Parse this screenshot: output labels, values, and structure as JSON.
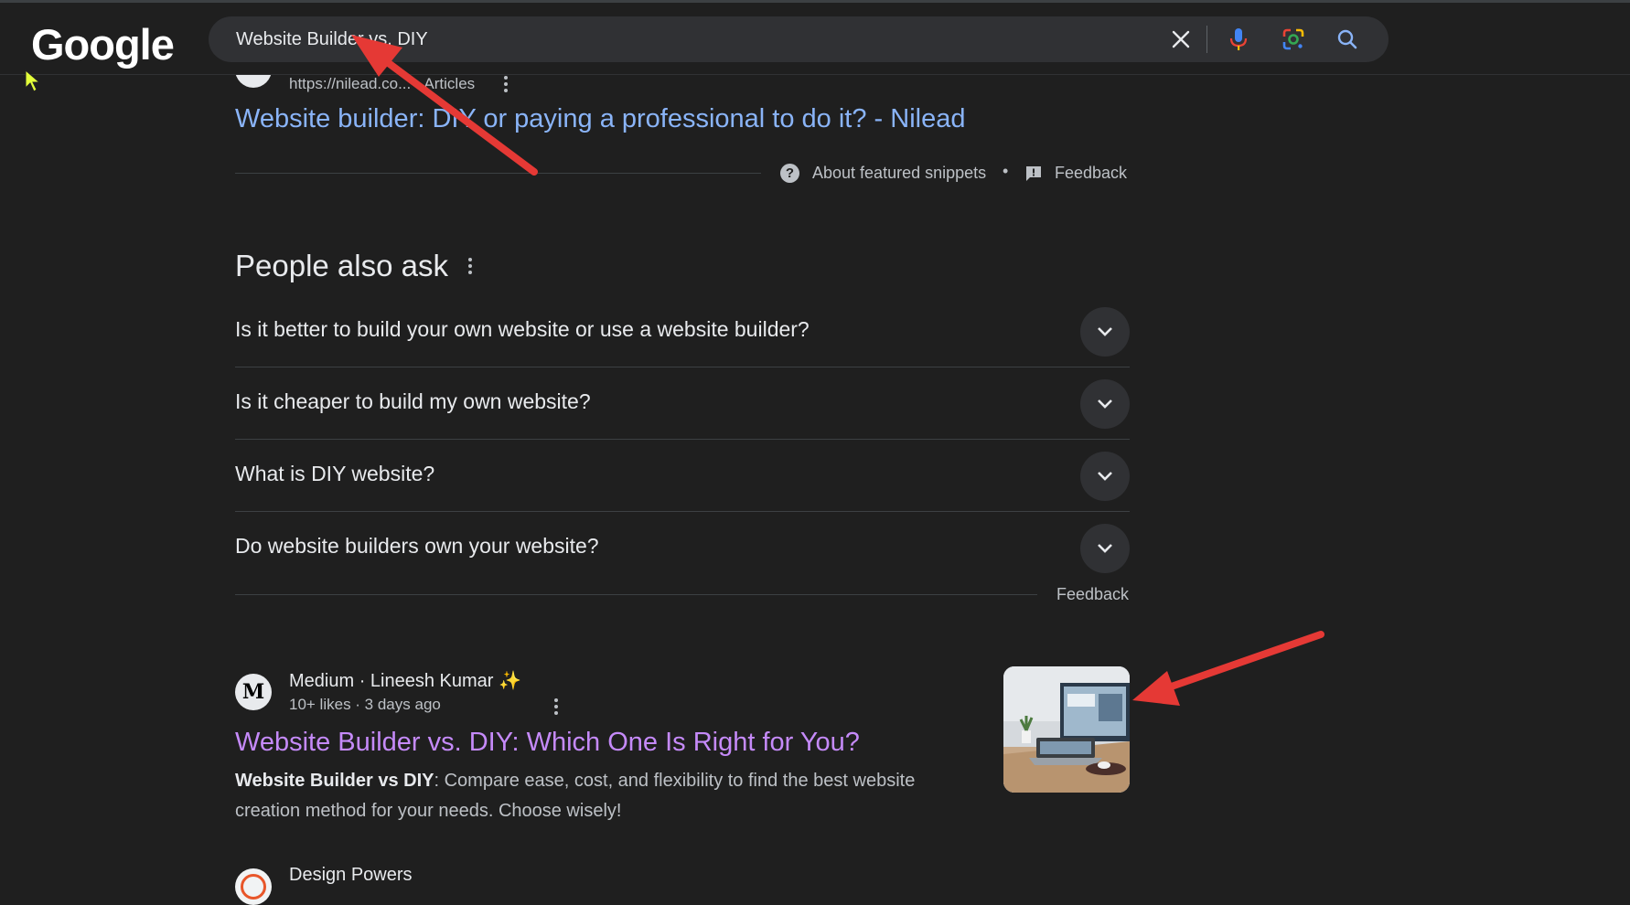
{
  "logo": "Google",
  "search": {
    "query": "Website Builder vs. DIY"
  },
  "icons": {
    "clear": "close-icon",
    "voice": "microphone-icon",
    "lens": "google-lens-icon",
    "search": "search-icon",
    "cursor": "mouse-cursor-icon",
    "annotation": "red-arrow-annotation-icon"
  },
  "featured": {
    "url": "https://nilead.co",
    "breadcrumb": "https://nilead.co... › Articles",
    "title": "Website builder: DIY or paying a professional to do it? - Nilead",
    "about_label": "About featured snippets",
    "feedback_label": "Feedback"
  },
  "paa": {
    "title": "People also ask",
    "questions": [
      "Is it better to build your own website or use a website builder?",
      "Is it cheaper to build my own website?",
      "What is DIY website?",
      "Do website builders own your website?"
    ],
    "feedback_label": "Feedback"
  },
  "result_medium": {
    "source": "Medium · Lineesh Kumar ✨",
    "meta": "10+ likes · 3 days ago",
    "title": "Website Builder vs. DIY: Which One Is Right for You?",
    "snippet_bold": "Website Builder vs DIY",
    "snippet_rest": ": Compare ease, cost, and flexibility to find the best website creation method for your needs. Choose wisely!"
  },
  "result_design": {
    "source": "Design Powers"
  },
  "colors": {
    "background": "#1f1f1f",
    "link": "#8ab4f8",
    "visited_link": "#c58af9",
    "annotation_arrow": "#e53935"
  }
}
